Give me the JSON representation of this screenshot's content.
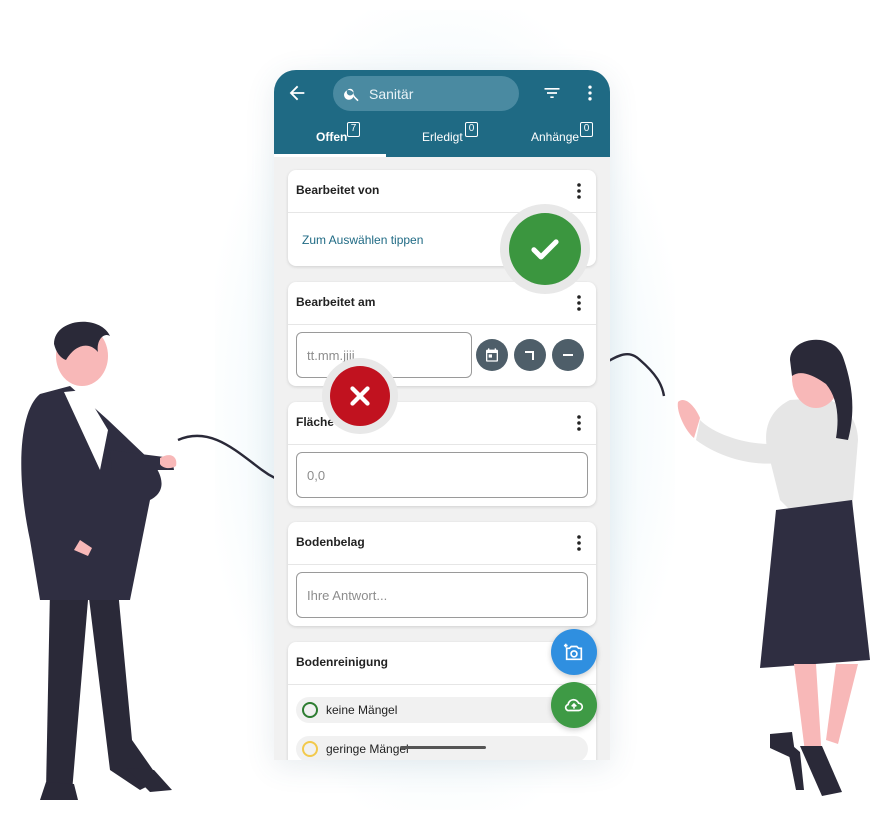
{
  "header": {
    "search_value": "Sanitär",
    "colors": {
      "appbar": "#1f6a84",
      "accent": "#1f6a84"
    },
    "icons": [
      "back-arrow-icon",
      "search-icon",
      "filter-icon",
      "more-vert-icon"
    ]
  },
  "tabs": [
    {
      "label": "Offen",
      "count": "7",
      "active": true
    },
    {
      "label": "Erledigt",
      "count": "0",
      "active": false
    },
    {
      "label": "Anhänge",
      "count": "0",
      "active": false
    }
  ],
  "cards": {
    "bearbeitet_von": {
      "title": "Bearbeitet von",
      "link": "Zum Auswählen tippen"
    },
    "bearbeitet_am": {
      "title": "Bearbeitet am",
      "placeholder": "tt.mm.jjjj"
    },
    "flaeche": {
      "title": "Fläche",
      "value": "0,0"
    },
    "bodenbelag": {
      "title": "Bodenbelag",
      "placeholder": "Ihre Antwort..."
    },
    "bodenreinigung": {
      "title": "Bodenreinigung",
      "options": [
        {
          "label": "keine Mängel",
          "color": "#2e7d32"
        },
        {
          "label": "geringe Mängel",
          "color": "#f2c94c"
        }
      ]
    }
  },
  "fabs": {
    "camera_color": "#2f8fe0",
    "upload_color": "#3e9a45"
  },
  "overlays": {
    "check_color": "#3b963f",
    "cross_color": "#c1121f"
  }
}
